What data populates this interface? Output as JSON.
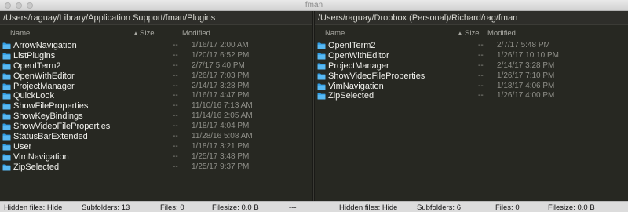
{
  "window": {
    "title": "fman"
  },
  "columns": {
    "name": "Name",
    "sort_indicator": "▲",
    "size": "Size",
    "modified": "Modified"
  },
  "left": {
    "path": "/Users/raguay/Library/Application Support/fman/Plugins",
    "files": [
      {
        "name": "ArrowNavigation",
        "size": "--",
        "modified": "1/16/17 2:00 AM"
      },
      {
        "name": "ListPlugins",
        "size": "--",
        "modified": "1/20/17 6:52 PM"
      },
      {
        "name": "OpenITerm2",
        "size": "--",
        "modified": "2/7/17 5:40 PM"
      },
      {
        "name": "OpenWithEditor",
        "size": "--",
        "modified": "1/26/17 7:03 PM"
      },
      {
        "name": "ProjectManager",
        "size": "--",
        "modified": "2/14/17 3:28 PM"
      },
      {
        "name": "QuickLook",
        "size": "--",
        "modified": "1/16/17 4:47 PM"
      },
      {
        "name": "ShowFileProperties",
        "size": "--",
        "modified": "11/10/16 7:13 AM"
      },
      {
        "name": "ShowKeyBindings",
        "size": "--",
        "modified": "11/14/16 2:05 AM"
      },
      {
        "name": "ShowVideoFileProperties",
        "size": "--",
        "modified": "1/18/17 4:04 PM"
      },
      {
        "name": "StatusBarExtended",
        "size": "--",
        "modified": "11/28/16 5:08 AM"
      },
      {
        "name": "User",
        "size": "--",
        "modified": "1/18/17 3:21 PM"
      },
      {
        "name": "VimNavigation",
        "size": "--",
        "modified": "1/25/17 3:48 PM"
      },
      {
        "name": "ZipSelected",
        "size": "--",
        "modified": "1/25/17 9:37 PM"
      }
    ]
  },
  "right": {
    "path": "/Users/raguay/Dropbox (Personal)/Richard/rag/fman",
    "files": [
      {
        "name": "OpenITerm2",
        "size": "--",
        "modified": "2/7/17 5:48 PM"
      },
      {
        "name": "OpenWithEditor",
        "size": "--",
        "modified": "1/26/17 10:10 PM"
      },
      {
        "name": "ProjectManager",
        "size": "--",
        "modified": "2/14/17 3:28 PM"
      },
      {
        "name": "ShowVideoFileProperties",
        "size": "--",
        "modified": "1/26/17 7:10 PM"
      },
      {
        "name": "VimNavigation",
        "size": "--",
        "modified": "1/18/17 4:06 PM"
      },
      {
        "name": "ZipSelected",
        "size": "--",
        "modified": "1/26/17 4:00 PM"
      }
    ]
  },
  "status": {
    "left": {
      "hidden": "Hidden files: Hide",
      "subfolders": "Subfolders: 13",
      "files": "Files: 0",
      "filesize": "Filesize: 0.0 B",
      "separator": "---"
    },
    "right": {
      "hidden": "Hidden files: Hide",
      "subfolders": "Subfolders: 6",
      "files": "Files: 0",
      "filesize": "Filesize: 0.0 B"
    }
  },
  "colors": {
    "folder": "#2f9ee6",
    "pane_bg": "#272822"
  },
  "icons": {
    "file_item": "folder-icon"
  }
}
